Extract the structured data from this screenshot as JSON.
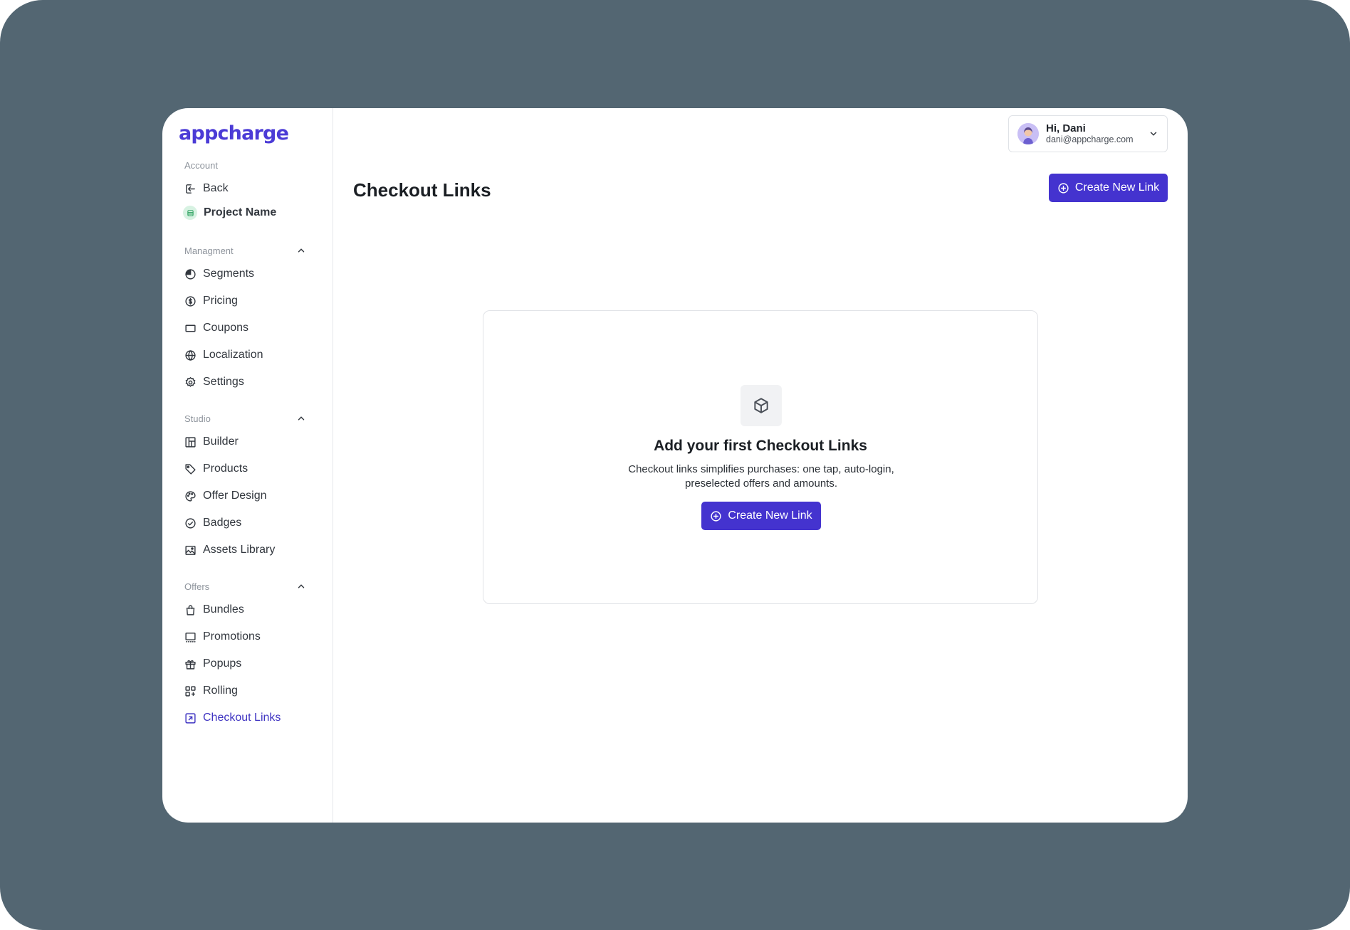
{
  "brand": {
    "logo_text": "appcharge",
    "accent": "#4433cf"
  },
  "sidebar": {
    "account_label": "Account",
    "back_label": "Back",
    "project_label": "Project Name",
    "management": {
      "label": "Managment",
      "items": [
        {
          "label": "Segments",
          "icon": "segments-icon"
        },
        {
          "label": "Pricing",
          "icon": "dollar-icon"
        },
        {
          "label": "Coupons",
          "icon": "coupon-icon"
        },
        {
          "label": "Localization",
          "icon": "globe-icon"
        },
        {
          "label": "Settings",
          "icon": "gear-icon"
        }
      ]
    },
    "studio": {
      "label": "Studio",
      "items": [
        {
          "label": "Builder",
          "icon": "builder-icon"
        },
        {
          "label": "Products",
          "icon": "tag-icon"
        },
        {
          "label": "Offer Design",
          "icon": "palette-icon"
        },
        {
          "label": "Badges",
          "icon": "badge-check-icon"
        },
        {
          "label": "Assets Library",
          "icon": "image-icon"
        }
      ]
    },
    "offers": {
      "label": "Offers",
      "items": [
        {
          "label": "Bundles",
          "icon": "bag-icon"
        },
        {
          "label": "Promotions",
          "icon": "promotion-icon"
        },
        {
          "label": "Popups",
          "icon": "gift-icon"
        },
        {
          "label": "Rolling",
          "icon": "rolling-icon"
        },
        {
          "label": "Checkout Links",
          "icon": "checkout-link-icon",
          "active": true
        }
      ]
    }
  },
  "user": {
    "greeting": "Hi, Dani",
    "email": "dani@appcharge.com"
  },
  "main": {
    "title": "Checkout Links",
    "create_button_label": "Create New Link",
    "empty_state": {
      "title": "Add your first Checkout Links",
      "description": "Checkout links simplifies purchases: one tap, auto-login, preselected offers and amounts.",
      "button_label": "Create New Link"
    }
  }
}
